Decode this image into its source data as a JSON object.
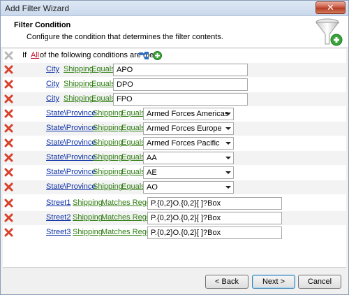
{
  "window": {
    "title": "Add Filter Wizard",
    "close_glyph": "✕"
  },
  "header": {
    "title": "Filter Condition",
    "description": "Configure the condition that determines the filter contents."
  },
  "group": {
    "prefix": "If",
    "quantifier": "All",
    "suffix": "of the following conditions are met"
  },
  "conditions": [
    {
      "field": "City",
      "source": "Shipping",
      "operator": "Equals",
      "value": "APO",
      "input": "text"
    },
    {
      "field": "City",
      "source": "Shipping",
      "operator": "Equals",
      "value": "DPO",
      "input": "text"
    },
    {
      "field": "City",
      "source": "Shipping",
      "operator": "Equals",
      "value": "FPO",
      "input": "text"
    },
    {
      "field": "State\\Province",
      "source": "Shipping",
      "operator": "Equals",
      "value": "Armed Forces Americas",
      "input": "combo"
    },
    {
      "field": "State\\Province",
      "source": "Shipping",
      "operator": "Equals",
      "value": "Armed Forces Europe",
      "input": "combo"
    },
    {
      "field": "State\\Province",
      "source": "Shipping",
      "operator": "Equals",
      "value": "Armed Forces Pacific",
      "input": "combo"
    },
    {
      "field": "State\\Province",
      "source": "Shipping",
      "operator": "Equals",
      "value": "AA",
      "input": "combo"
    },
    {
      "field": "State\\Province",
      "source": "Shipping",
      "operator": "Equals",
      "value": "AE",
      "input": "combo"
    },
    {
      "field": "State\\Province",
      "source": "Shipping",
      "operator": "Equals",
      "value": "AO",
      "input": "combo"
    },
    {
      "field": "Street1",
      "source": "Shipping",
      "operator": "Matches Regex",
      "value": "P.{0,2}O.{0,2}[ ]?Box",
      "input": "text"
    },
    {
      "field": "Street2",
      "source": "Shipping",
      "operator": "Matches Regex",
      "value": "P.{0,2}O.{0,2}[ ]?Box",
      "input": "text"
    },
    {
      "field": "Street3",
      "source": "Shipping",
      "operator": "Matches Regex",
      "value": "P.{0,2}O.{0,2}[ ]?Box",
      "input": "text"
    }
  ],
  "buttons": {
    "back": "< Back",
    "next": "Next >",
    "cancel": "Cancel"
  },
  "colors": {
    "field_link": "#0b2fa6",
    "source_link": "#2f7d12",
    "operator_link": "#2f7d12",
    "quantifier_link": "#c8102e",
    "delete_icon": "#d8402a",
    "add_icon": "#3aa33a"
  },
  "icons": {
    "delete": "red-x-icon",
    "add": "green-plus-icon",
    "group": "group-tree-icon",
    "header": "funnel-add-icon"
  }
}
